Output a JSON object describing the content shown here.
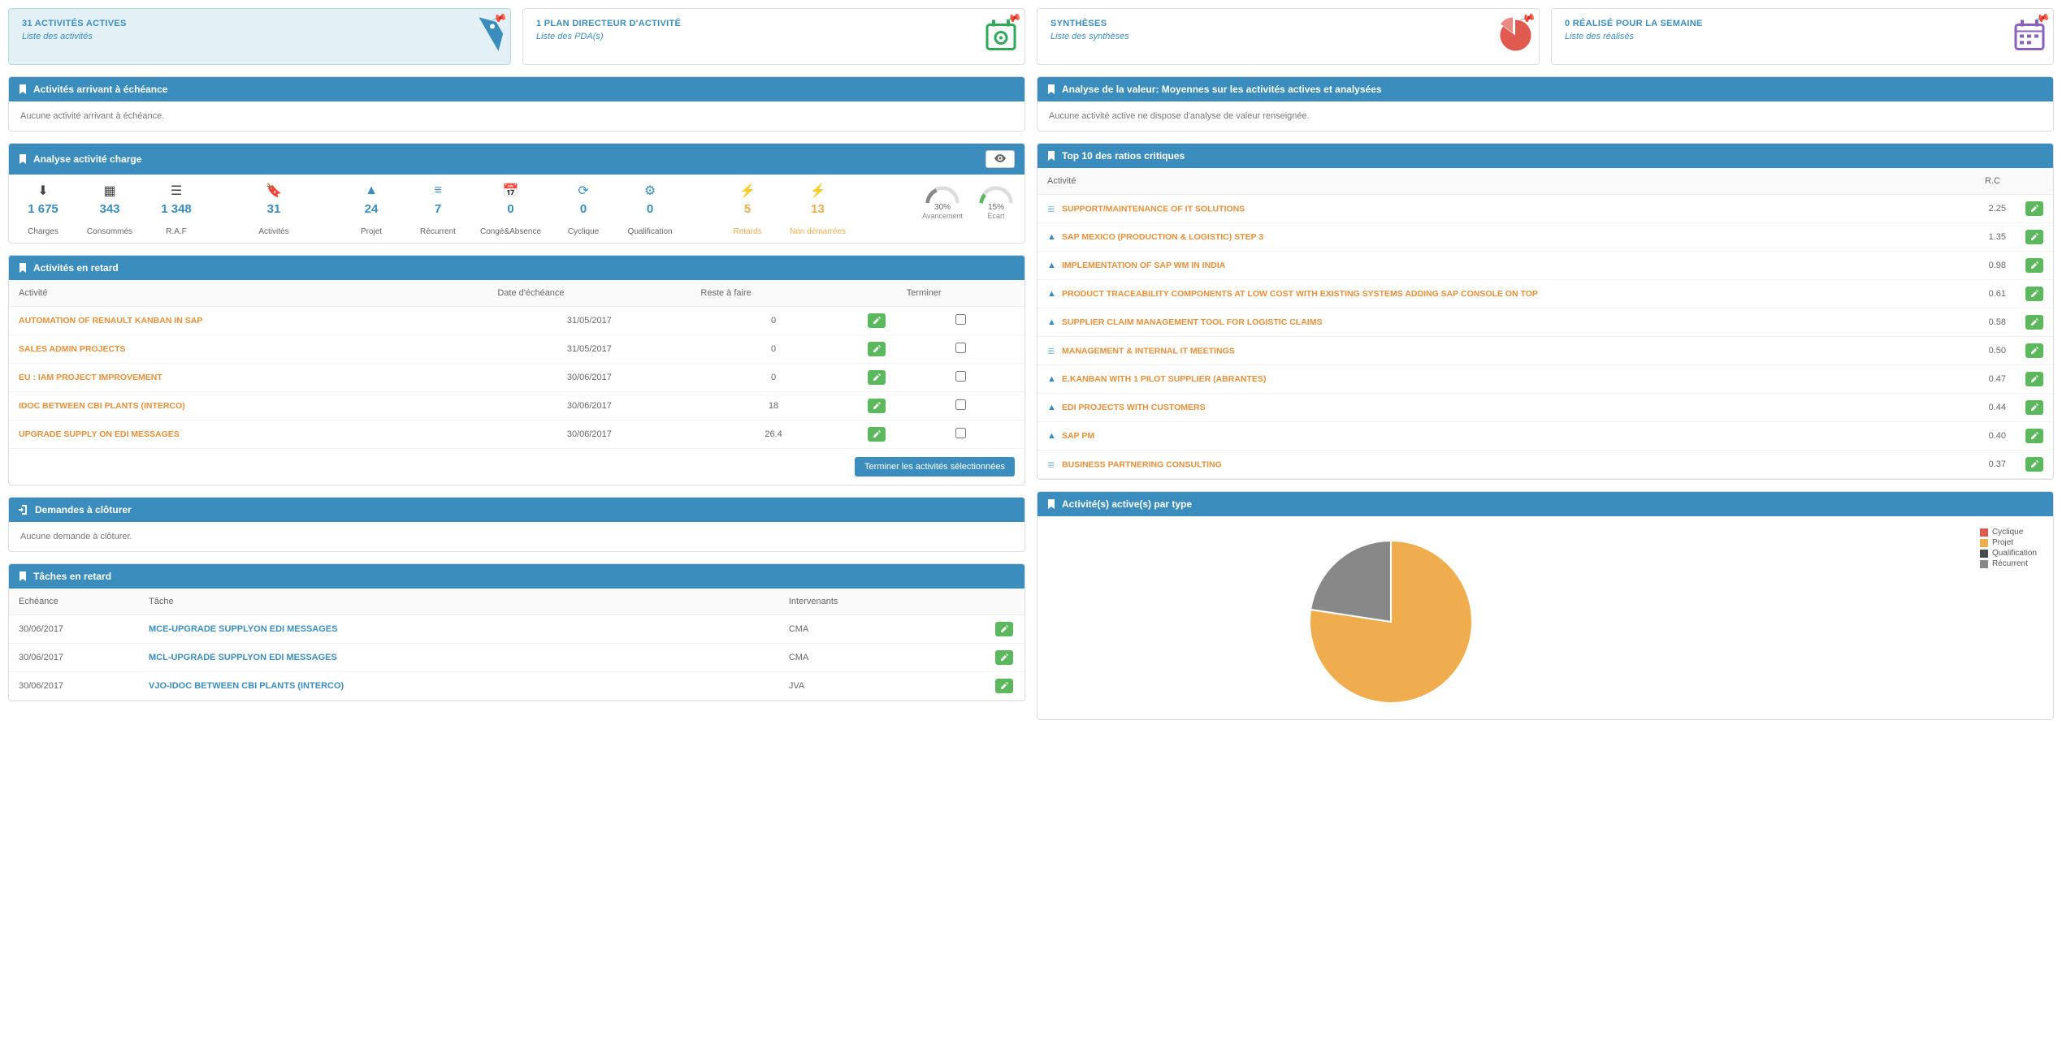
{
  "top_cards": [
    {
      "title": "31 ACTIVITÉS ACTIVES",
      "subtitle": "Liste des activités",
      "icon": "tag",
      "color": "#3b8dbd",
      "active": true
    },
    {
      "title": "1 PLAN DIRECTEUR D'ACTIVITÉ",
      "subtitle": "Liste des PDA(s)",
      "icon": "calendar-gear",
      "color": "#2fa85a",
      "active": false
    },
    {
      "title": "SYNTHÈSES",
      "subtitle": "Liste des synthèses",
      "icon": "pie",
      "color": "#e15a4f",
      "active": false
    },
    {
      "title": "0 RÉALISÉ POUR LA SEMAINE",
      "subtitle": "Liste des réalisés",
      "icon": "calendar",
      "color": "#8a5fbf",
      "active": false
    }
  ],
  "panels": {
    "echeance": {
      "title": "Activités arrivant à échéance",
      "empty": "Aucune activité arrivant à échéance."
    },
    "valeur": {
      "title": "Analyse de la valeur: Moyennes sur les activités actives et analysées",
      "empty": "Aucune activité active ne dispose d'analyse de valeur renseignée."
    },
    "charge": {
      "title": "Analyse activité charge",
      "charges": {
        "charges": "1 675",
        "consommes": "343",
        "raf": "1 348"
      },
      "activites": "31",
      "types": {
        "projet": "24",
        "recurrent": "7",
        "conge": "0",
        "cyclique": "0",
        "qualification": "0"
      },
      "alerts": {
        "retards": "5",
        "non_demarrees": "13"
      },
      "gauges": {
        "avancement": "30%",
        "avancement_label": "Avancement",
        "ecart": "15%",
        "ecart_label": "Ecart"
      },
      "labels": {
        "charges": "Charges",
        "consommes": "Consommés",
        "raf": "R.A.F",
        "activites": "Activités",
        "projet": "Projet",
        "recurrent": "Récurrent",
        "conge": "Congé&Absence",
        "cyclique": "Cyclique",
        "qualification": "Qualification",
        "retards": "Retards",
        "non_demarrees": "Non démarrées"
      }
    },
    "retard": {
      "title": "Activités en retard",
      "headers": {
        "activite": "Activité",
        "echeance": "Date d'échéance",
        "reste": "Reste à faire",
        "terminer": "Terminer"
      },
      "rows": [
        {
          "name": "AUTOMATION OF RENAULT KANBAN IN SAP",
          "date": "31/05/2017",
          "reste": "0"
        },
        {
          "name": "SALES ADMIN PROJECTS",
          "date": "31/05/2017",
          "reste": "0"
        },
        {
          "name": "EU : IAM PROJECT IMPROVEMENT",
          "date": "30/06/2017",
          "reste": "0"
        },
        {
          "name": "IDOC BETWEEN CBI PLANTS (INTERCO)",
          "date": "30/06/2017",
          "reste": "18"
        },
        {
          "name": "UPGRADE SUPPLY ON EDI MESSAGES",
          "date": "30/06/2017",
          "reste": "26.4"
        }
      ],
      "button": "Terminer les activités sélectionnées"
    },
    "ratios": {
      "title": "Top 10 des ratios critiques",
      "headers": {
        "activite": "Activité",
        "rc": "R.C"
      },
      "rows": [
        {
          "icon": "bars-l",
          "name": "SUPPORT/MAINTENANCE OF IT SOLUTIONS",
          "rc": "2.25"
        },
        {
          "icon": "road",
          "name": "SAP MEXICO (PRODUCTION & LOGISTIC) STEP 3",
          "rc": "1.35"
        },
        {
          "icon": "road",
          "name": "IMPLEMENTATION OF SAP WM IN INDIA",
          "rc": "0.98"
        },
        {
          "icon": "road",
          "name": "PRODUCT TRACEABILITY COMPONENTS AT LOW COST WITH EXISTING SYSTEMS ADDING SAP CONSOLE ON TOP",
          "rc": "0.61"
        },
        {
          "icon": "road",
          "name": "SUPPLIER CLAIM MANAGEMENT TOOL FOR LOGISTIC CLAIMS",
          "rc": "0.58"
        },
        {
          "icon": "bars-l",
          "name": "MANAGEMENT & INTERNAL IT MEETINGS",
          "rc": "0.50"
        },
        {
          "icon": "road",
          "name": "E.KANBAN WITH 1 PILOT SUPPLIER (ABRANTES)",
          "rc": "0.47"
        },
        {
          "icon": "road",
          "name": "EDI PROJECTS WITH CUSTOMERS",
          "rc": "0.44"
        },
        {
          "icon": "road",
          "name": "SAP PM",
          "rc": "0.40"
        },
        {
          "icon": "bars-l",
          "name": "BUSINESS PARTNERING CONSULTING",
          "rc": "0.37"
        }
      ]
    },
    "cloturer": {
      "title": "Demandes à clôturer",
      "empty": "Aucune demande à clôturer."
    },
    "taches": {
      "title": "Tâches en retard",
      "headers": {
        "echeance": "Echéance",
        "tache": "Tâche",
        "intervenants": "Intervenants"
      },
      "rows": [
        {
          "date": "30/06/2017",
          "name": "MCE-UPGRADE SUPPLYON EDI MESSAGES",
          "who": "CMA"
        },
        {
          "date": "30/06/2017",
          "name": "MCL-UPGRADE SUPPLYON EDI MESSAGES",
          "who": "CMA"
        },
        {
          "date": "30/06/2017",
          "name": "VJO-IDOC BETWEEN CBI PLANTS (INTERCO)",
          "who": "JVA"
        }
      ]
    },
    "pie": {
      "title": "Activité(s) active(s) par type",
      "legend": [
        {
          "label": "Cyclique",
          "color": "#e15a4f"
        },
        {
          "label": "Projet",
          "color": "#f0ad4e"
        },
        {
          "label": "Qualification",
          "color": "#4a4a4a"
        },
        {
          "label": "Récurrent",
          "color": "#888888"
        }
      ]
    }
  },
  "chart_data": {
    "type": "pie",
    "title": "Activité(s) active(s) par type",
    "series": [
      {
        "name": "Cyclique",
        "value": 0,
        "color": "#e15a4f"
      },
      {
        "name": "Projet",
        "value": 24,
        "color": "#f0ad4e"
      },
      {
        "name": "Qualification",
        "value": 0,
        "color": "#4a4a4a"
      },
      {
        "name": "Récurrent",
        "value": 7,
        "color": "#888888"
      }
    ],
    "total": 31
  }
}
